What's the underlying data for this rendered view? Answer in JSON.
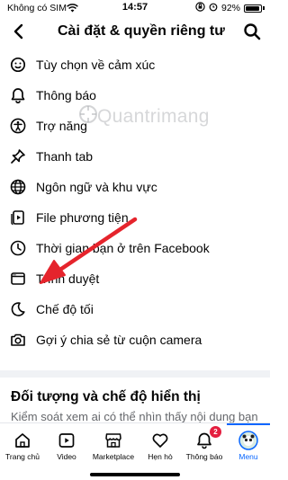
{
  "status_bar": {
    "carrier": "Không có SIM",
    "time": "14:57",
    "battery": "92%",
    "battery_level": 0.92
  },
  "header": {
    "title": "Cài đặt & quyền riêng tư"
  },
  "menu": {
    "items": [
      {
        "label": "Tùy chọn về cảm xúc",
        "icon": "emotion-settings-icon"
      },
      {
        "label": "Thông báo",
        "icon": "bell-icon"
      },
      {
        "label": "Trợ năng",
        "icon": "accessibility-icon"
      },
      {
        "label": "Thanh tab",
        "icon": "pin-icon"
      },
      {
        "label": "Ngôn ngữ và khu vực",
        "icon": "globe-icon"
      },
      {
        "label": "File phương tiện",
        "icon": "media-file-icon"
      },
      {
        "label": "Thời gian bạn ở trên Facebook",
        "icon": "clock-icon"
      },
      {
        "label": "Trình duyệt",
        "icon": "browser-icon"
      },
      {
        "label": "Chế độ tối",
        "icon": "moon-icon"
      },
      {
        "label": "Gợi ý chia sẻ từ cuộn camera",
        "icon": "camera-icon"
      }
    ]
  },
  "section": {
    "title": "Đối tượng và chế độ hiển thị",
    "description": "Kiểm soát xem ai có thể nhìn thấy nội dung bạn chia sẻ trên Facebook."
  },
  "watermark": "Quantrimang",
  "annotation_color": "#e5242c",
  "accent_color": "#0866ff",
  "tabbar": {
    "tabs": [
      {
        "label": "Trang chủ",
        "icon": "home-icon"
      },
      {
        "label": "Video",
        "icon": "video-icon"
      },
      {
        "label": "Marketplace",
        "icon": "marketplace-icon"
      },
      {
        "label": "Hẹn hò",
        "icon": "heart-icon"
      },
      {
        "label": "Thông báo",
        "icon": "bell-icon",
        "badge": "2"
      },
      {
        "label": "Menu",
        "icon": "avatar-icon",
        "active": true
      }
    ]
  }
}
